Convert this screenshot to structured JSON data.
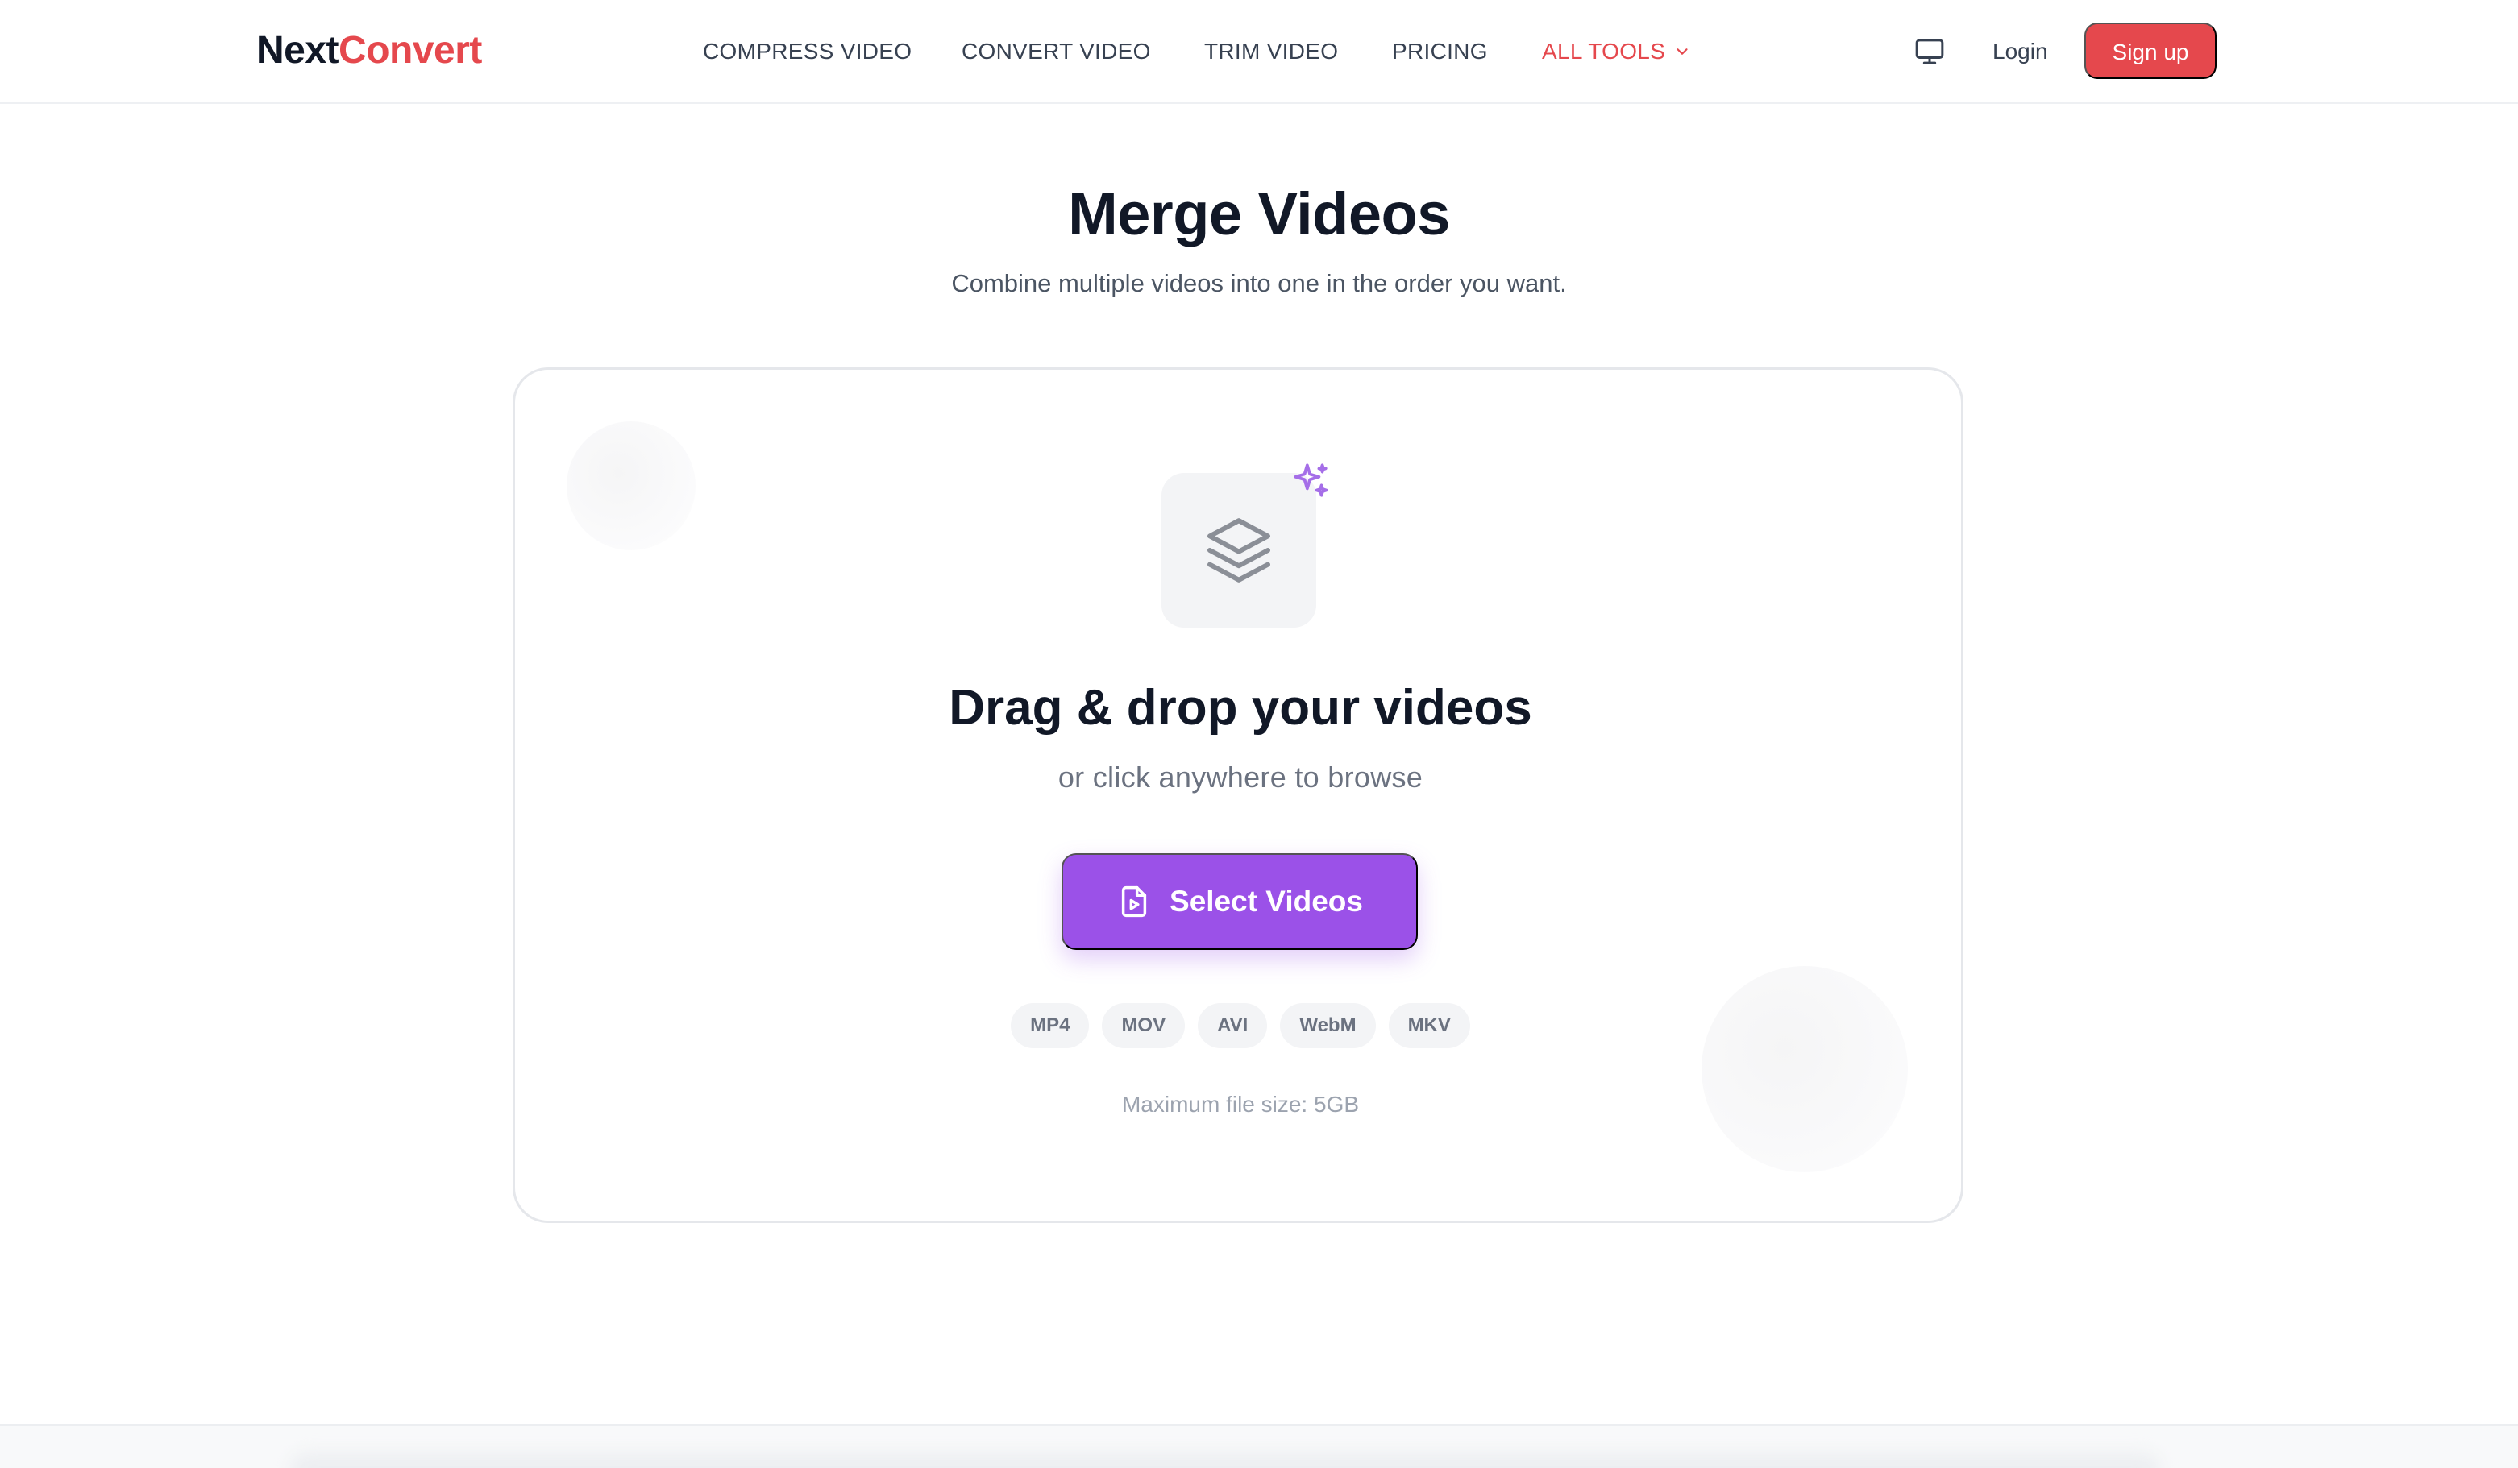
{
  "header": {
    "logo_part1": "Next",
    "logo_part2": "Convert",
    "nav": [
      {
        "label": "COMPRESS VIDEO"
      },
      {
        "label": "CONVERT VIDEO"
      },
      {
        "label": "TRIM VIDEO"
      },
      {
        "label": "PRICING"
      },
      {
        "label": "ALL TOOLS"
      }
    ],
    "login_label": "Login",
    "signup_label": "Sign up",
    "icons": {
      "display": "monitor-icon",
      "dropdown": "chevron-down-icon"
    }
  },
  "hero": {
    "title": "Merge Videos",
    "subtitle": "Combine multiple videos into one in the order you want."
  },
  "dropzone": {
    "title": "Drag & drop your videos",
    "subtitle": "or click anywhere to browse",
    "button_label": "Select Videos",
    "formats": [
      "MP4",
      "MOV",
      "AVI",
      "WebM",
      "MKV"
    ],
    "max_size": "Maximum file size: 5GB",
    "icons": {
      "main": "layers-icon",
      "badge": "sparkles-icon",
      "button": "video-file-icon"
    }
  },
  "colors": {
    "brand_red": "#e5484d",
    "accent_purple": "#9b51e8",
    "text_dark": "#111827",
    "text_muted": "#6b7280"
  }
}
